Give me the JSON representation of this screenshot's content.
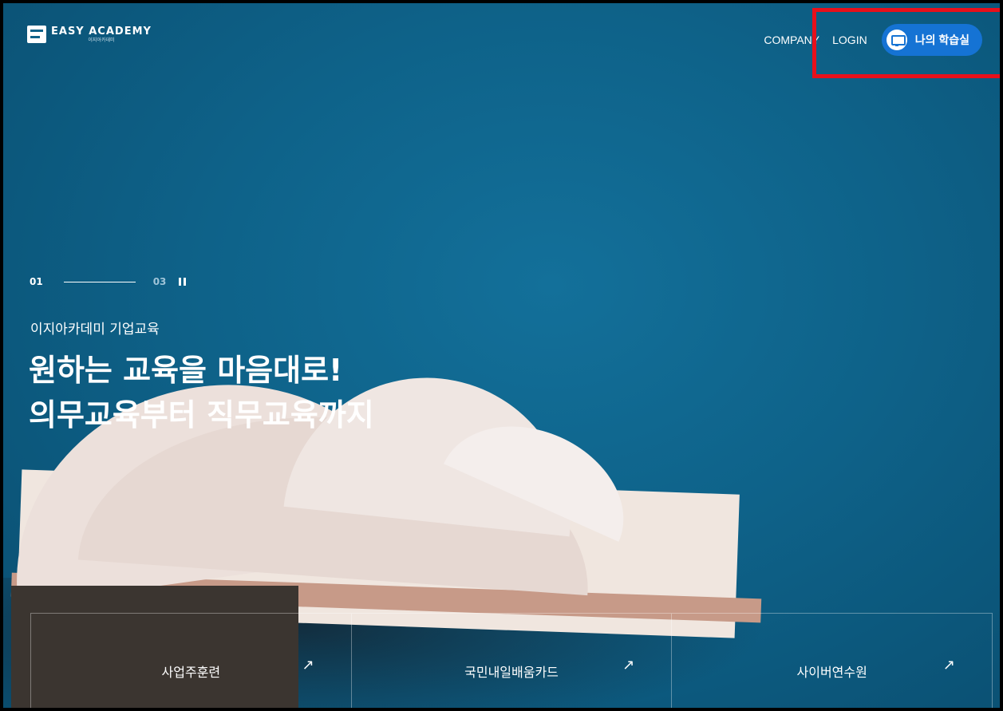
{
  "header": {
    "logo_title": "EASY ACADEMY",
    "logo_sub": "이지아카데미",
    "nav": {
      "company": "COMPANY",
      "login": "LOGIN",
      "my_room": "나의 학습실"
    }
  },
  "hero": {
    "pager": {
      "current": "01",
      "total": "03"
    },
    "eyebrow": "이지아카데미 기업교육",
    "headline_1": "원하는 교육을 마음대로!",
    "headline_2": "의무교육부터 직무교육까지"
  },
  "menu": [
    {
      "label": "사업주훈련",
      "arrow": "↗"
    },
    {
      "label": "국민내일배움카드",
      "arrow": "↗"
    },
    {
      "label": "사이버연수원",
      "arrow": "↗"
    }
  ],
  "colors": {
    "background": "#0e6289",
    "button": "#1573d4",
    "highlight": "#e8101b"
  }
}
